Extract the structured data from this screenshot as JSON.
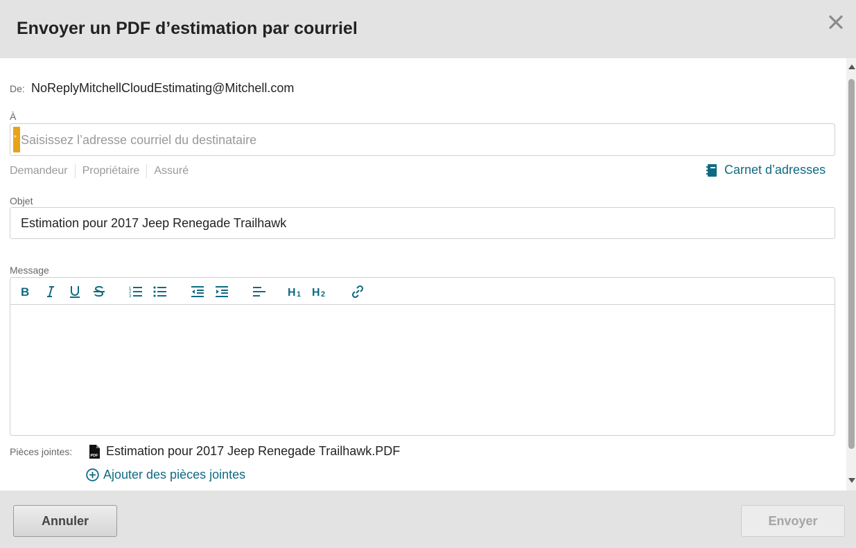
{
  "dialog": {
    "title": "Envoyer un PDF d’estimation par courriel",
    "close_icon": "close-icon"
  },
  "from": {
    "label": "De:",
    "value": "NoReplyMitchellCloudEstimating@Mitchell.com"
  },
  "to": {
    "label": "À",
    "placeholder": "Saisissez l’adresse courriel du destinataire",
    "value": "",
    "required_marker": "*",
    "required_color": "#e8a319",
    "quick_recipients": [
      "Demandeur",
      "Propriétaire",
      "Assuré"
    ],
    "address_book_label": "Carnet d’adresses",
    "address_book_icon": "address-book-icon"
  },
  "subject": {
    "label": "Objet",
    "value": "Estimation pour 2017 Jeep Renegade Trailhawk"
  },
  "message": {
    "label": "Message",
    "value": "",
    "toolbar": [
      {
        "name": "bold-button",
        "icon": "bold-icon",
        "text": "B"
      },
      {
        "name": "italic-button",
        "icon": "italic-icon",
        "text": "I"
      },
      {
        "name": "underline-button",
        "icon": "underline-icon",
        "text": "U"
      },
      {
        "name": "strikethrough-button",
        "icon": "strikethrough-icon",
        "text": "S"
      },
      {
        "name": "ordered-list-button",
        "icon": "ordered-list-icon"
      },
      {
        "name": "bullet-list-button",
        "icon": "bullet-list-icon"
      },
      {
        "name": "outdent-button",
        "icon": "outdent-icon"
      },
      {
        "name": "indent-button",
        "icon": "indent-icon"
      },
      {
        "name": "align-button",
        "icon": "align-left-icon"
      },
      {
        "name": "heading1-button",
        "icon": "heading1-icon",
        "text": "H1"
      },
      {
        "name": "heading2-button",
        "icon": "heading2-icon",
        "text": "H2"
      },
      {
        "name": "link-button",
        "icon": "link-icon"
      }
    ]
  },
  "attachments": {
    "label": "Pièces jointes:",
    "files": [
      "Estimation pour 2017 Jeep Renegade Trailhawk.PDF"
    ],
    "file_icon": "pdf-file-icon",
    "add_label": "Ajouter des pièces jointes",
    "add_icon": "plus-circle-icon"
  },
  "footer": {
    "cancel_label": "Annuler",
    "send_label": "Envoyer"
  },
  "colors": {
    "accent": "#0e6a82",
    "header_bg": "#e3e3e3",
    "required": "#e8a319"
  }
}
